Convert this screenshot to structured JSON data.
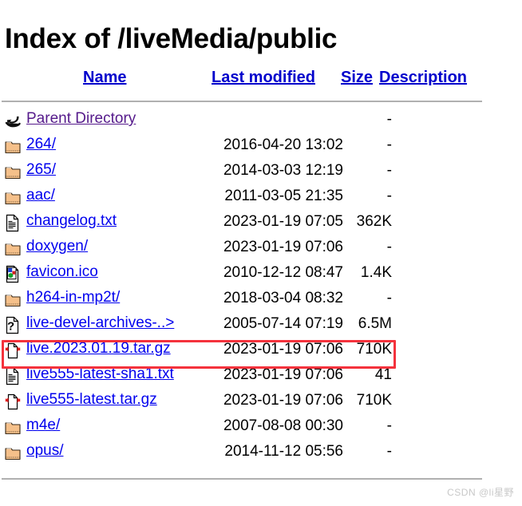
{
  "page": {
    "title": "Index of /liveMedia/public",
    "watermark": "CSDN @li星野"
  },
  "colors": {
    "link": "#0000ee",
    "visited_link": "#551a8b",
    "header_link": "#0000cc",
    "highlight_border": "#f4323c",
    "rule": "#b0b0b0",
    "watermark": "#c8c8c8",
    "folder": "#f5c08a",
    "text": "#000000"
  },
  "header": {
    "name": "Name",
    "last_modified": "Last modified",
    "size": "Size",
    "description": "Description"
  },
  "rows": [
    {
      "icon": "parent-directory-icon",
      "name": "Parent Directory",
      "last_modified": "",
      "size": "-",
      "description": "",
      "visited": true,
      "highlighted": false
    },
    {
      "icon": "folder-icon",
      "name": "264/",
      "last_modified": "2016-04-20 13:02",
      "size": "-",
      "description": "",
      "visited": false,
      "highlighted": false
    },
    {
      "icon": "folder-icon",
      "name": "265/",
      "last_modified": "2014-03-03 12:19",
      "size": "-",
      "description": "",
      "visited": false,
      "highlighted": false
    },
    {
      "icon": "folder-icon",
      "name": "aac/",
      "last_modified": "2011-03-05 21:35",
      "size": "-",
      "description": "",
      "visited": false,
      "highlighted": false
    },
    {
      "icon": "text-file-icon",
      "name": "changelog.txt",
      "last_modified": "2023-01-19 07:05",
      "size": "362K",
      "description": "",
      "visited": false,
      "highlighted": false
    },
    {
      "icon": "folder-icon",
      "name": "doxygen/",
      "last_modified": "2023-01-19 07:06",
      "size": "-",
      "description": "",
      "visited": false,
      "highlighted": false
    },
    {
      "icon": "image-file-icon",
      "name": "favicon.ico",
      "last_modified": "2010-12-12 08:47",
      "size": "1.4K",
      "description": "",
      "visited": false,
      "highlighted": false
    },
    {
      "icon": "folder-icon",
      "name": "h264-in-mp2t/",
      "last_modified": "2018-03-04 08:32",
      "size": "-",
      "description": "",
      "visited": false,
      "highlighted": false
    },
    {
      "icon": "unknown-file-icon",
      "name": "live-devel-archives-..>",
      "last_modified": "2005-07-14 07:19",
      "size": "6.5M",
      "description": "",
      "visited": false,
      "highlighted": false
    },
    {
      "icon": "compressed-file-icon",
      "name": "live.2023.01.19.tar.gz",
      "last_modified": "2023-01-19 07:06",
      "size": "710K",
      "description": "",
      "visited": false,
      "highlighted": true
    },
    {
      "icon": "text-file-icon",
      "name": "live555-latest-sha1.txt",
      "last_modified": "2023-01-19 07:06",
      "size": "41",
      "description": "",
      "visited": false,
      "highlighted": false
    },
    {
      "icon": "compressed-file-icon",
      "name": "live555-latest.tar.gz",
      "last_modified": "2023-01-19 07:06",
      "size": "710K",
      "description": "",
      "visited": false,
      "highlighted": false
    },
    {
      "icon": "folder-icon",
      "name": "m4e/",
      "last_modified": "2007-08-08 00:30",
      "size": "-",
      "description": "",
      "visited": false,
      "highlighted": false
    },
    {
      "icon": "folder-icon",
      "name": "opus/",
      "last_modified": "2014-11-12 05:56",
      "size": "-",
      "description": "",
      "visited": false,
      "highlighted": false
    }
  ]
}
